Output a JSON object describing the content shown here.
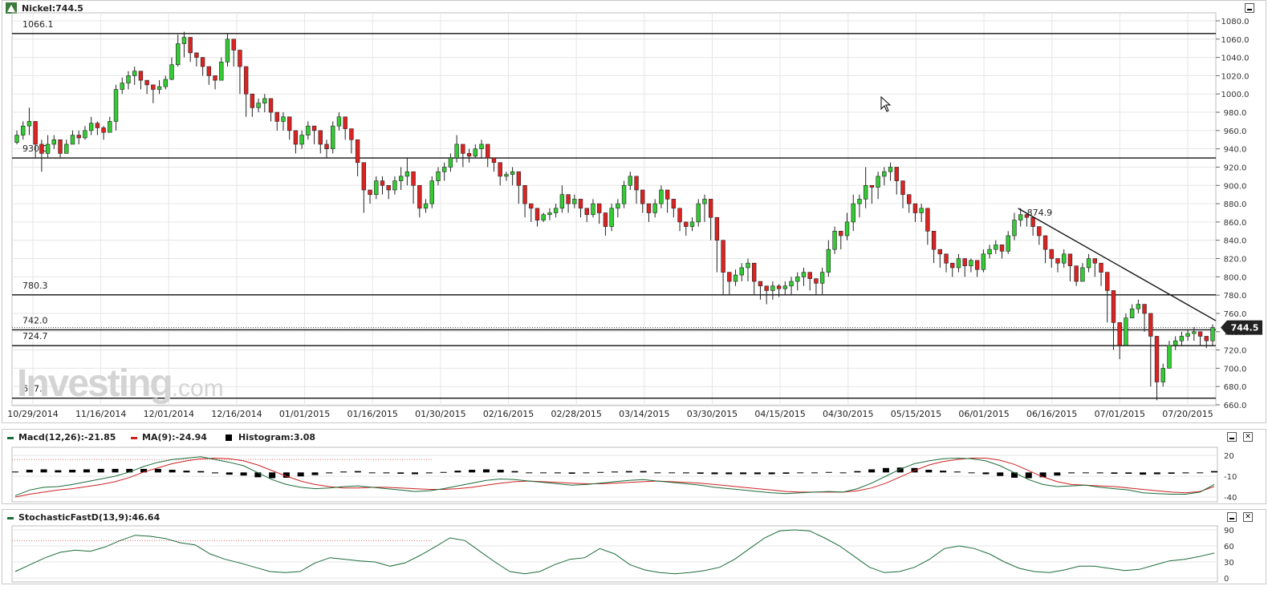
{
  "main": {
    "title": "Nickel:744.5",
    "last_price": "744.5",
    "hlines": [
      {
        "label": "1066.1",
        "value": 1066.1
      },
      {
        "label": "930.0",
        "value": 930.0
      },
      {
        "label": "780.3",
        "value": 780.3
      },
      {
        "label": "742.0",
        "value": 742.0
      },
      {
        "label": "724.7",
        "value": 724.7
      },
      {
        "label": "667.3",
        "value": 667.3
      }
    ],
    "trend_label": "874.9",
    "logo_text": "Investing",
    "logo_suffix": ".com"
  },
  "macd": {
    "macd_label": "Macd(12,26):-21.85",
    "ma_label": "MA(9):-24.94",
    "hist_label": "Histogram:3.08",
    "y_ticks": [
      "20",
      "-10",
      "-40"
    ]
  },
  "stoch": {
    "label": "StochasticFastD(13,9):46.64",
    "y_ticks": [
      "90",
      "60",
      "30",
      "0"
    ]
  },
  "colors": {
    "up": "#33cc33",
    "down": "#dd2222",
    "macd_line": "#1a6b3a",
    "ma_line": "#cc2222",
    "grid": "#e6e6e6"
  },
  "chart_data": [
    {
      "type": "candlestick",
      "title": "Nickel:744.5",
      "x_tick_labels": [
        "10/29/2014",
        "11/16/2014",
        "12/01/2014",
        "12/16/2014",
        "01/01/2015",
        "01/16/2015",
        "01/30/2015",
        "02/16/2015",
        "02/28/2015",
        "03/14/2015",
        "03/30/2015",
        "04/15/2015",
        "04/30/2015",
        "05/15/2015",
        "06/01/2015",
        "06/16/2015",
        "07/01/2015",
        "07/20/2015"
      ],
      "y_ticks": [
        1080.0,
        1060.0,
        1040.0,
        1020.0,
        1000.0,
        980.0,
        960.0,
        940.0,
        920.0,
        900.0,
        880.0,
        860.0,
        840.0,
        820.0,
        800.0,
        780.0,
        760.0,
        740.0,
        720.0,
        700.0,
        680.0,
        660.0
      ],
      "ylim": [
        660,
        1080
      ],
      "grid": true,
      "close": [
        955,
        965,
        970,
        945,
        935,
        945,
        950,
        935,
        945,
        955,
        952,
        960,
        968,
        963,
        958,
        970,
        1005,
        1012,
        1020,
        1025,
        1015,
        1010,
        1005,
        1008,
        1016,
        1032,
        1055,
        1062,
        1045,
        1040,
        1030,
        1020,
        1015,
        1035,
        1060,
        1048,
        1030,
        1000,
        985,
        990,
        995,
        980,
        970,
        975,
        960,
        945,
        955,
        965,
        960,
        945,
        940,
        965,
        975,
        962,
        950,
        925,
        895,
        890,
        905,
        900,
        895,
        905,
        910,
        915,
        900,
        875,
        880,
        905,
        915,
        920,
        930,
        945,
        935,
        932,
        940,
        945,
        930,
        925,
        910,
        912,
        915,
        900,
        880,
        875,
        862,
        868,
        870,
        875,
        890,
        880,
        885,
        875,
        868,
        880,
        870,
        855,
        875,
        880,
        900,
        910,
        895,
        880,
        870,
        880,
        895,
        885,
        875,
        860,
        855,
        860,
        880,
        885,
        865,
        840,
        805,
        795,
        802,
        810,
        815,
        795,
        790,
        785,
        790,
        787,
        790,
        795,
        800,
        805,
        798,
        793,
        805,
        830,
        850,
        845,
        860,
        880,
        885,
        900,
        898,
        910,
        915,
        920,
        905,
        890,
        880,
        870,
        875,
        850,
        830,
        825,
        815,
        810,
        820,
        812,
        818,
        808,
        825,
        830,
        835,
        828,
        845,
        862,
        868,
        865,
        855,
        845,
        830,
        820,
        815,
        825,
        812,
        795,
        810,
        820,
        815,
        805,
        785,
        750,
        725,
        755,
        765,
        770,
        760,
        735,
        685,
        700,
        725,
        730,
        735,
        738,
        740,
        735,
        730,
        744.5
      ],
      "high": [
        960,
        970,
        985,
        955,
        950,
        955,
        955,
        945,
        950,
        960,
        960,
        965,
        975,
        970,
        965,
        975,
        1010,
        1018,
        1025,
        1030,
        1020,
        1015,
        1010,
        1015,
        1020,
        1040,
        1065,
        1068,
        1050,
        1045,
        1035,
        1025,
        1020,
        1040,
        1066,
        1055,
        1040,
        1005,
        990,
        995,
        1000,
        990,
        975,
        980,
        965,
        950,
        960,
        970,
        965,
        950,
        950,
        970,
        980,
        970,
        955,
        930,
        900,
        895,
        910,
        910,
        900,
        910,
        920,
        930,
        905,
        880,
        885,
        910,
        920,
        925,
        935,
        955,
        940,
        940,
        945,
        950,
        935,
        930,
        915,
        915,
        920,
        905,
        885,
        880,
        865,
        870,
        875,
        880,
        900,
        885,
        890,
        880,
        870,
        885,
        875,
        860,
        880,
        885,
        905,
        915,
        900,
        885,
        875,
        885,
        900,
        890,
        880,
        865,
        860,
        865,
        885,
        890,
        870,
        845,
        810,
        800,
        808,
        815,
        820,
        800,
        795,
        790,
        795,
        792,
        795,
        800,
        805,
        810,
        803,
        798,
        810,
        840,
        855,
        850,
        870,
        890,
        890,
        920,
        900,
        915,
        920,
        925,
        910,
        895,
        885,
        875,
        880,
        855,
        835,
        830,
        820,
        815,
        825,
        815,
        820,
        812,
        830,
        835,
        840,
        835,
        850,
        870,
        874.9,
        870,
        860,
        850,
        835,
        825,
        820,
        830,
        815,
        800,
        815,
        825,
        820,
        810,
        790,
        755,
        730,
        760,
        770,
        775,
        765,
        740,
        690,
        705,
        730,
        735,
        740,
        742,
        745,
        740,
        735,
        748
      ],
      "low": [
        945,
        950,
        955,
        930,
        915,
        930,
        940,
        930,
        935,
        945,
        945,
        950,
        955,
        955,
        950,
        960,
        960,
        1000,
        1005,
        1010,
        1005,
        1000,
        990,
        1000,
        1005,
        1015,
        1030,
        1040,
        1035,
        1030,
        1020,
        1010,
        1005,
        1015,
        1030,
        1030,
        1000,
        975,
        975,
        980,
        980,
        970,
        960,
        960,
        950,
        935,
        940,
        950,
        945,
        935,
        930,
        935,
        960,
        950,
        935,
        910,
        870,
        880,
        885,
        890,
        885,
        890,
        895,
        900,
        880,
        865,
        870,
        875,
        900,
        905,
        915,
        925,
        920,
        925,
        930,
        930,
        920,
        915,
        900,
        905,
        900,
        880,
        865,
        860,
        855,
        860,
        862,
        865,
        870,
        870,
        875,
        865,
        860,
        865,
        858,
        845,
        850,
        865,
        875,
        895,
        880,
        870,
        860,
        865,
        875,
        870,
        865,
        850,
        845,
        850,
        855,
        860,
        840,
        805,
        780,
        780,
        790,
        795,
        795,
        780,
        775,
        770,
        775,
        778,
        780,
        780,
        785,
        790,
        785,
        780,
        780,
        800,
        825,
        830,
        840,
        850,
        865,
        875,
        880,
        885,
        900,
        905,
        890,
        875,
        870,
        860,
        860,
        835,
        815,
        810,
        805,
        800,
        805,
        800,
        805,
        800,
        805,
        820,
        825,
        820,
        825,
        840,
        855,
        855,
        845,
        835,
        815,
        810,
        805,
        810,
        795,
        790,
        795,
        805,
        800,
        790,
        750,
        720,
        710,
        725,
        755,
        760,
        740,
        680,
        665,
        680,
        700,
        720,
        725,
        730,
        730,
        725,
        722,
        725
      ]
    },
    {
      "type": "line",
      "title": "Macd(12,26):-21.85",
      "ylim": [
        -40,
        20
      ],
      "y_ticks": [
        20,
        -10,
        -40
      ],
      "series": [
        {
          "name": "Macd(12,26)",
          "values": [
            -38,
            -30,
            -26,
            -25,
            -22,
            -18,
            -14,
            -10,
            -4,
            4,
            10,
            14,
            16,
            18,
            14,
            10,
            5,
            -5,
            -15,
            -22,
            -26,
            -28,
            -27,
            -25,
            -24,
            -26,
            -28,
            -30,
            -32,
            -31,
            -28,
            -24,
            -20,
            -16,
            -14,
            -15,
            -17,
            -19,
            -21,
            -23,
            -22,
            -20,
            -18,
            -16,
            -15,
            -17,
            -19,
            -21,
            -23,
            -26,
            -28,
            -30,
            -32,
            -34,
            -35,
            -34,
            -33,
            -32,
            -33,
            -28,
            -20,
            -10,
            0,
            8,
            12,
            15,
            16,
            15,
            12,
            5,
            -5,
            -15,
            -22,
            -25,
            -24,
            -23,
            -26,
            -28,
            -30,
            -34,
            -35,
            -36,
            -36,
            -33,
            -21.85
          ]
        },
        {
          "name": "MA(9)",
          "values": [
            -40,
            -36,
            -33,
            -30,
            -28,
            -25,
            -22,
            -18,
            -12,
            -4,
            2,
            8,
            12,
            15,
            16,
            15,
            12,
            6,
            -2,
            -10,
            -17,
            -22,
            -25,
            -27,
            -27,
            -26,
            -26,
            -27,
            -28,
            -29,
            -29,
            -28,
            -26,
            -23,
            -20,
            -18,
            -17,
            -18,
            -19,
            -20,
            -21,
            -21,
            -20,
            -19,
            -18,
            -17,
            -18,
            -19,
            -20,
            -22,
            -24,
            -26,
            -28,
            -30,
            -32,
            -33,
            -33,
            -33,
            -33,
            -31,
            -27,
            -20,
            -11,
            -2,
            6,
            11,
            14,
            16,
            16,
            13,
            7,
            -2,
            -11,
            -18,
            -22,
            -23,
            -24,
            -25,
            -27,
            -29,
            -31,
            -33,
            -34,
            -32,
            -24.94
          ]
        },
        {
          "name": "Histogram",
          "values": [
            2,
            6,
            7,
            5,
            6,
            7,
            8,
            8,
            8,
            8,
            8,
            6,
            4,
            3,
            -2,
            -5,
            -7,
            -11,
            -13,
            -12,
            -9,
            -6,
            -2,
            2,
            3,
            0,
            -2,
            -3,
            -4,
            -2,
            1,
            4,
            6,
            7,
            6,
            3,
            0,
            -1,
            -2,
            -3,
            -1,
            1,
            2,
            3,
            3,
            0,
            -1,
            -2,
            -3,
            -4,
            -4,
            -4,
            -4,
            -4,
            -3,
            -1,
            0,
            1,
            0,
            3,
            7,
            10,
            11,
            10,
            6,
            4,
            2,
            -1,
            -4,
            -8,
            -12,
            -13,
            -11,
            -7,
            -2,
            0,
            -2,
            -3,
            -3,
            -5,
            -4,
            -3,
            -2,
            -1,
            3.08
          ]
        }
      ]
    },
    {
      "type": "line",
      "title": "StochasticFastD(13,9):46.64",
      "ylim": [
        0,
        100
      ],
      "y_ticks": [
        90,
        60,
        30,
        0
      ],
      "series": [
        {
          "name": "StochasticFastD(13,9)",
          "values": [
            12,
            25,
            38,
            48,
            52,
            50,
            58,
            70,
            80,
            78,
            74,
            66,
            62,
            45,
            35,
            28,
            20,
            12,
            10,
            12,
            28,
            38,
            35,
            32,
            30,
            22,
            28,
            42,
            58,
            75,
            70,
            50,
            30,
            12,
            8,
            12,
            25,
            35,
            38,
            55,
            45,
            25,
            15,
            10,
            8,
            10,
            14,
            20,
            35,
            55,
            75,
            88,
            90,
            88,
            75,
            60,
            40,
            20,
            10,
            12,
            20,
            35,
            55,
            60,
            55,
            45,
            30,
            18,
            12,
            10,
            15,
            22,
            22,
            18,
            14,
            16,
            24,
            32,
            35,
            40,
            46.64
          ]
        }
      ]
    }
  ]
}
